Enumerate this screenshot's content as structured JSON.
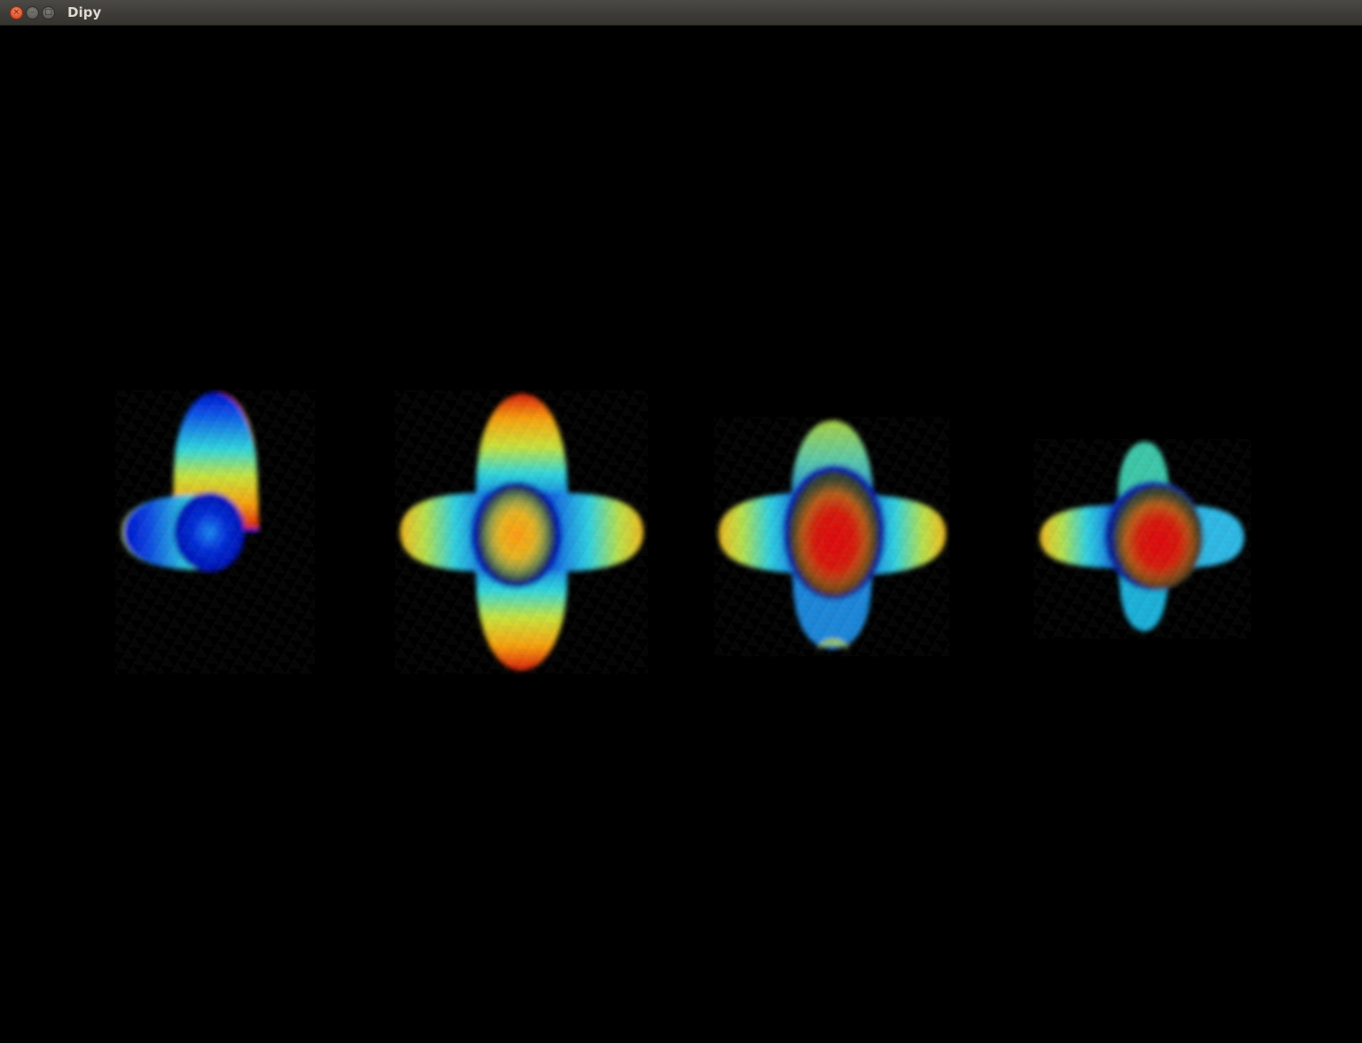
{
  "window": {
    "title": "Dipy",
    "close_glyph": "×",
    "minimize_glyph": "–",
    "maximize_glyph": "□"
  },
  "scene": {
    "background": "#000000",
    "glyph_count": 4,
    "colormap": "jet",
    "glyphs": [
      {
        "name": "odf-glyph-1",
        "center_value": "low"
      },
      {
        "name": "odf-glyph-2",
        "center_value": "medium"
      },
      {
        "name": "odf-glyph-3",
        "center_value": "high"
      },
      {
        "name": "odf-glyph-4",
        "center_value": "high"
      }
    ]
  }
}
